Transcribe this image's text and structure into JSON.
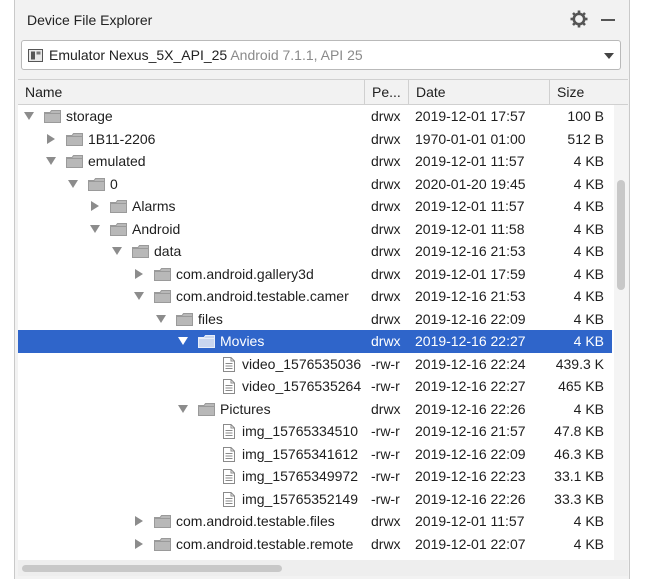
{
  "panel": {
    "title": "Device File Explorer"
  },
  "device": {
    "name": "Emulator Nexus_5X_API_25",
    "meta": "Android 7.1.1, API 25"
  },
  "columns": {
    "name": "Name",
    "permissions": "Pe...",
    "date": "Date",
    "size": "Size"
  },
  "rows": [
    {
      "name": "storage",
      "perm": "drwx",
      "date": "2019-12-01 17:57",
      "size": "100 B",
      "depth": 0,
      "toggle": "open",
      "type": "folder"
    },
    {
      "name": "1B11-2206",
      "perm": "drwx",
      "date": "1970-01-01 01:00",
      "size": "512 B",
      "depth": 1,
      "toggle": "closed",
      "type": "folder"
    },
    {
      "name": "emulated",
      "perm": "drwx",
      "date": "2019-12-01 11:57",
      "size": "4 KB",
      "depth": 1,
      "toggle": "open",
      "type": "folder"
    },
    {
      "name": "0",
      "perm": "drwx",
      "date": "2020-01-20 19:45",
      "size": "4 KB",
      "depth": 2,
      "toggle": "open",
      "type": "folder"
    },
    {
      "name": "Alarms",
      "perm": "drwx",
      "date": "2019-12-01 11:57",
      "size": "4 KB",
      "depth": 3,
      "toggle": "closed",
      "type": "folder"
    },
    {
      "name": "Android",
      "perm": "drwx",
      "date": "2019-12-01 11:58",
      "size": "4 KB",
      "depth": 3,
      "toggle": "open",
      "type": "folder"
    },
    {
      "name": "data",
      "perm": "drwx",
      "date": "2019-12-16 21:53",
      "size": "4 KB",
      "depth": 4,
      "toggle": "open",
      "type": "folder"
    },
    {
      "name": "com.android.gallery3d",
      "perm": "drwx",
      "date": "2019-12-01 17:59",
      "size": "4 KB",
      "depth": 5,
      "toggle": "closed",
      "type": "folder"
    },
    {
      "name": "com.android.testable.camer",
      "perm": "drwx",
      "date": "2019-12-16 21:53",
      "size": "4 KB",
      "depth": 5,
      "toggle": "open",
      "type": "folder"
    },
    {
      "name": "files",
      "perm": "drwx",
      "date": "2019-12-16 22:09",
      "size": "4 KB",
      "depth": 6,
      "toggle": "open",
      "type": "folder"
    },
    {
      "name": "Movies",
      "perm": "drwx",
      "date": "2019-12-16 22:27",
      "size": "4 KB",
      "depth": 7,
      "toggle": "open",
      "type": "folder",
      "selected": true
    },
    {
      "name": "video_1576535036",
      "perm": "-rw-r",
      "date": "2019-12-16 22:24",
      "size": "439.3 K",
      "depth": 8,
      "toggle": "none",
      "type": "file"
    },
    {
      "name": "video_1576535264",
      "perm": "-rw-r",
      "date": "2019-12-16 22:27",
      "size": "465 KB",
      "depth": 8,
      "toggle": "none",
      "type": "file"
    },
    {
      "name": "Pictures",
      "perm": "drwx",
      "date": "2019-12-16 22:26",
      "size": "4 KB",
      "depth": 7,
      "toggle": "open",
      "type": "folder"
    },
    {
      "name": "img_15765334510",
      "perm": "-rw-r",
      "date": "2019-12-16 21:57",
      "size": "47.8 KB",
      "depth": 8,
      "toggle": "none",
      "type": "file"
    },
    {
      "name": "img_15765341612",
      "perm": "-rw-r",
      "date": "2019-12-16 22:09",
      "size": "46.3 KB",
      "depth": 8,
      "toggle": "none",
      "type": "file"
    },
    {
      "name": "img_15765349972",
      "perm": "-rw-r",
      "date": "2019-12-16 22:23",
      "size": "33.1 KB",
      "depth": 8,
      "toggle": "none",
      "type": "file"
    },
    {
      "name": "img_15765352149",
      "perm": "-rw-r",
      "date": "2019-12-16 22:26",
      "size": "33.3 KB",
      "depth": 8,
      "toggle": "none",
      "type": "file"
    },
    {
      "name": "com.android.testable.files",
      "perm": "drwx",
      "date": "2019-12-01 11:57",
      "size": "4 KB",
      "depth": 5,
      "toggle": "closed",
      "type": "folder"
    },
    {
      "name": "com.android.testable.remote",
      "perm": "drwx",
      "date": "2019-12-01 22:07",
      "size": "4 KB",
      "depth": 5,
      "toggle": "closed",
      "type": "folder"
    }
  ],
  "icons": {
    "settings": "gear-icon",
    "minimize": "minimize-icon",
    "device": "device-icon",
    "dropdown": "chevron-down-icon",
    "folder": "folder-icon",
    "file": "file-icon"
  },
  "colors": {
    "selection": "#2f65ca",
    "panel_bg": "#f2f2f2",
    "muted_text": "#8a8a8a"
  }
}
